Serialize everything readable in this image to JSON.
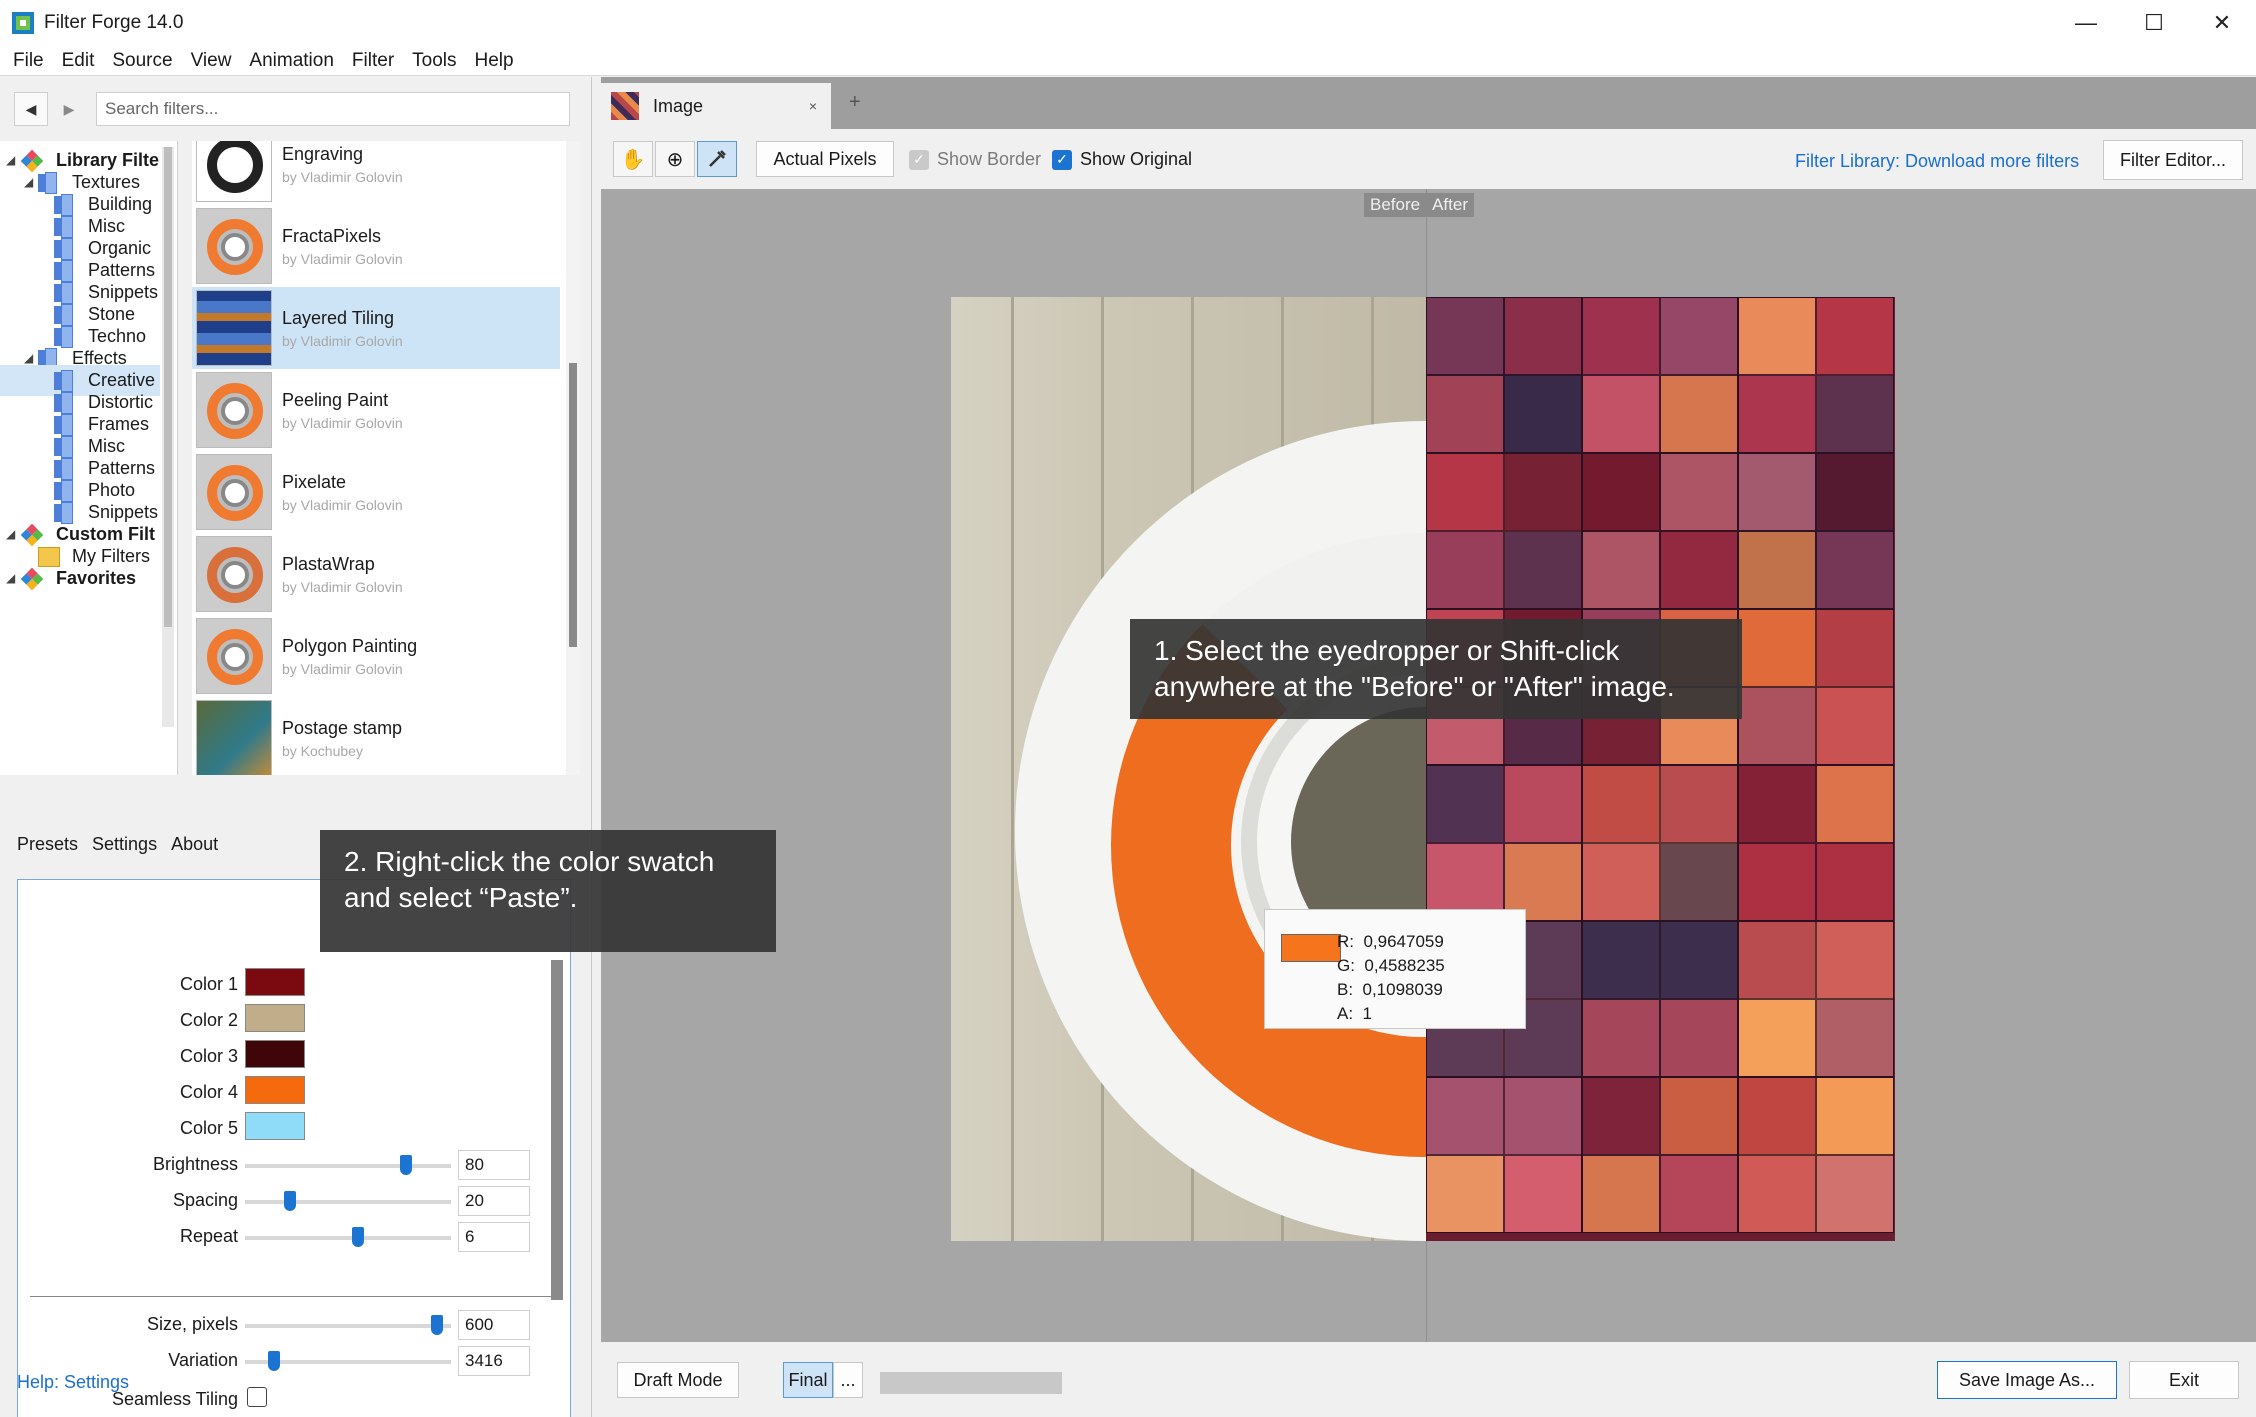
{
  "window": {
    "title": "Filter Forge 14.0",
    "minimize": "—",
    "maximize": "☐",
    "close": "✕"
  },
  "menu": [
    "File",
    "Edit",
    "Source",
    "View",
    "Animation",
    "Filter",
    "Tools",
    "Help"
  ],
  "search": {
    "placeholder": "Search filters..."
  },
  "tree": {
    "library": "Library Filte",
    "textures": "Textures",
    "texture_items": [
      "Building",
      "Misc",
      "Organic",
      "Patterns",
      "Snippets",
      "Stone",
      "Techno"
    ],
    "effects": "Effects",
    "effect_items": [
      "Creative",
      "Distortic",
      "Frames",
      "Misc",
      "Patterns",
      "Photo",
      "Snippets"
    ],
    "selected": "Creative",
    "custom": "Custom Filt",
    "my_filters": "My Filters",
    "favorites": "Favorites"
  },
  "filters": [
    {
      "name": "Engraving",
      "author": "by Vladimir Golovin"
    },
    {
      "name": "FractaPixels",
      "author": "by Vladimir Golovin"
    },
    {
      "name": "Layered Tiling",
      "author": "by Vladimir Golovin",
      "selected": true
    },
    {
      "name": "Peeling Paint",
      "author": "by Vladimir Golovin"
    },
    {
      "name": "Pixelate",
      "author": "by Vladimir Golovin"
    },
    {
      "name": "PlastaWrap",
      "author": "by Vladimir Golovin"
    },
    {
      "name": "Polygon Painting",
      "author": "by Vladimir Golovin"
    },
    {
      "name": "Postage stamp",
      "author": "by Kochubey"
    }
  ],
  "settings_tabs": [
    "Presets",
    "Settings",
    "About"
  ],
  "colors": [
    {
      "label": "Color 1",
      "hex": "#7a0a10"
    },
    {
      "label": "Color 2",
      "hex": "#c2ad8a"
    },
    {
      "label": "Color 3",
      "hex": "#3e0609"
    },
    {
      "label": "Color 4",
      "hex": "#f66a0e"
    },
    {
      "label": "Color 5",
      "hex": "#8fdcf8"
    }
  ],
  "sliders": [
    {
      "label": "Brightness",
      "value": "80",
      "level": 0.8
    },
    {
      "label": "Spacing",
      "value": "20",
      "level": 0.2
    },
    {
      "label": "Repeat",
      "value": "6",
      "level": 0.55
    }
  ],
  "sliders2": [
    {
      "label": "Size, pixels",
      "value": "600",
      "level": 0.96
    },
    {
      "label": "Variation",
      "value": "3416",
      "level": 0.12
    }
  ],
  "seamless": {
    "label": "Seamless Tiling",
    "checked": false
  },
  "help_link": "Help: Settings",
  "doc_tab": {
    "title": "Image",
    "close": "×",
    "plus": "+"
  },
  "toolbar": {
    "actual_pixels": "Actual Pixels",
    "show_border": "Show Border",
    "show_original": "Show Original",
    "library_link": "Filter Library: Download more filters",
    "filter_editor": "Filter Editor..."
  },
  "before_label": "Before",
  "after_label": "After",
  "callout1": [
    "1. Select the eyedropper or Shift-click",
    "anywhere at the \"Before\" or \"After\" image."
  ],
  "callout2": [
    "2. Right-click the color swatch",
    "and select “Paste”."
  ],
  "color_tip": {
    "r": "R:  0,9647059",
    "g": "G:  0,4588235",
    "b": "B:  0,1098039",
    "a": "A:  1",
    "hex": "#f6751c"
  },
  "status": {
    "draft_mode": "Draft Mode",
    "final": "Final",
    "more": "...",
    "save": "Save Image As...",
    "exit": "Exit"
  },
  "accent": "#1b73d2"
}
